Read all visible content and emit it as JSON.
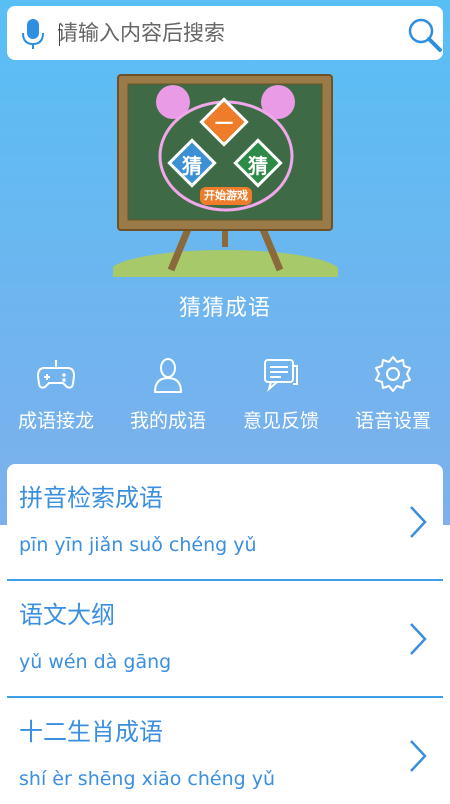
{
  "search": {
    "placeholder": "请输入内容后搜索"
  },
  "board": {
    "char_top": "一",
    "char_left": "猜",
    "char_right": "猜",
    "start_button": "开始游戏"
  },
  "game_title": "猜猜成语",
  "menu": [
    {
      "label": "成语接龙",
      "icon": "gamepad-icon"
    },
    {
      "label": "我的成语",
      "icon": "user-icon"
    },
    {
      "label": "意见反馈",
      "icon": "feedback-icon"
    },
    {
      "label": "语音设置",
      "icon": "gear-icon"
    }
  ],
  "list": [
    {
      "title": "拼音检索成语",
      "pinyin": "pīn yīn jiǎn suǒ chéng yǔ"
    },
    {
      "title": "语文大纲",
      "pinyin": "yǔ wén dà gāng"
    },
    {
      "title": "十二生肖成语",
      "pinyin": "shí èr shēng xiāo chéng yǔ"
    }
  ],
  "colors": {
    "background": "#6fb5ef",
    "accent": "#3a8fe0",
    "board_green": "#3e6b45",
    "frame_brown": "#8a6a3a"
  }
}
